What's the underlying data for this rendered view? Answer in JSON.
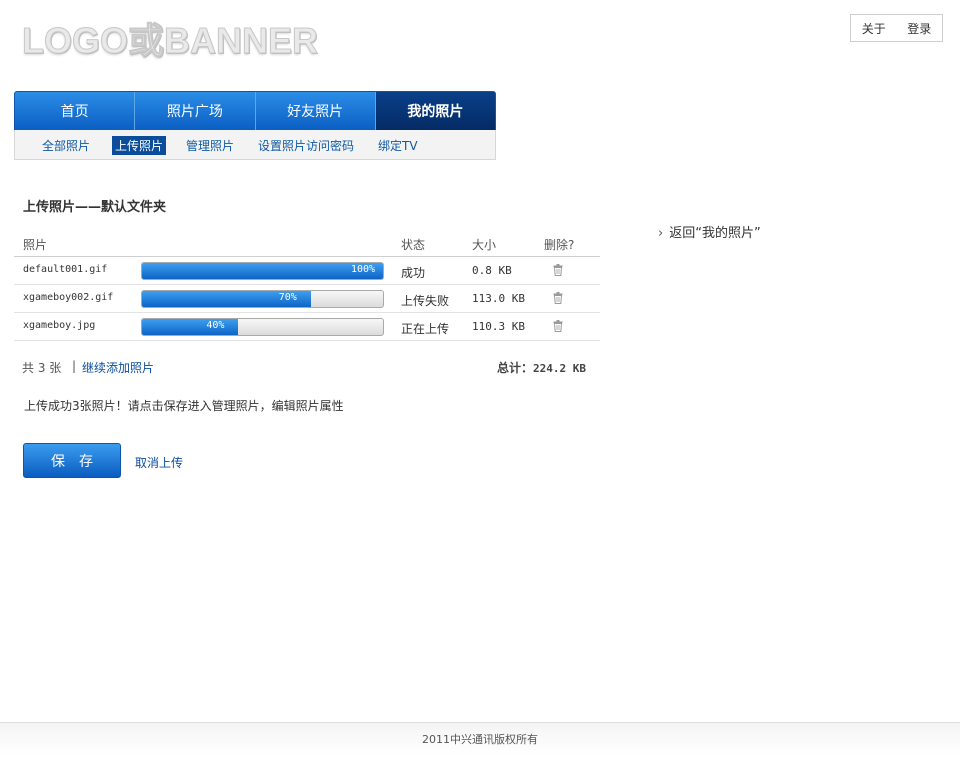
{
  "header": {
    "logo_text": "LOGO或BANNER",
    "links": {
      "about": "关于",
      "login": "登录"
    }
  },
  "nav": {
    "tabs": [
      {
        "label": "首页"
      },
      {
        "label": "照片广场"
      },
      {
        "label": "好友照片"
      },
      {
        "label": "我的照片",
        "active": true
      }
    ]
  },
  "subnav": {
    "items": [
      {
        "label": "全部照片"
      },
      {
        "label": "上传照片",
        "active": true
      },
      {
        "label": "管理照片"
      },
      {
        "label": "设置照片访问密码"
      },
      {
        "label": "绑定TV"
      }
    ]
  },
  "upload": {
    "title": "上传照片——默认文件夹",
    "columns": {
      "photo": "照片",
      "status": "状态",
      "size": "大小",
      "delete": "删除?"
    },
    "rows": [
      {
        "name": "default001.gif",
        "progress": 100,
        "progress_label": "100%",
        "status": "成功",
        "size": "0.8 KB"
      },
      {
        "name": "xgameboy002.gif",
        "progress": 70,
        "progress_label": "70%",
        "status": "上传失败",
        "size": "113.0 KB"
      },
      {
        "name": "xgameboy.jpg",
        "progress": 40,
        "progress_label": "40%",
        "status": "正在上传",
        "size": "110.3 KB"
      }
    ],
    "count_text": "共 3 张",
    "separator": "|",
    "add_more": "继续添加照片",
    "total_label": "总计：",
    "total_value": "224.2 KB",
    "message": "上传成功3张照片！请点击保存进入管理照片，编辑照片属性",
    "save_button": "保存",
    "cancel_link": "取消上传"
  },
  "sidebar": {
    "back_link": "返回“我的照片”"
  },
  "footer": {
    "copyright": "2011中兴通讯版权所有"
  },
  "colors": {
    "accent": "#0b5fc3",
    "nav_active": "#052b64",
    "link": "#0b4d9b"
  },
  "icons": {
    "delete": "trash-icon",
    "back": "chevron-right-icon"
  }
}
